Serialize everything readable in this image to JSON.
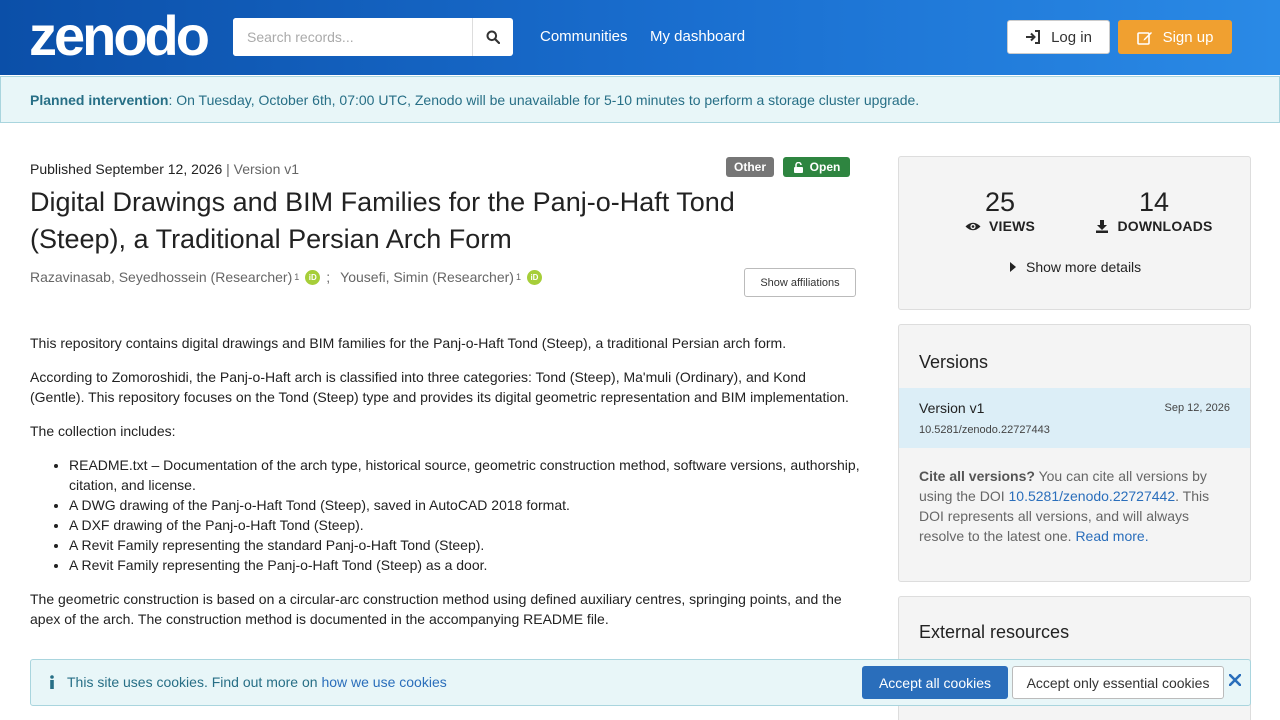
{
  "header": {
    "logo": "zenodo",
    "search_placeholder": "Search records...",
    "nav": [
      "Communities",
      "My dashboard"
    ],
    "login_label": "Log in",
    "signup_label": "Sign up",
    "signup_color": "#f0a030"
  },
  "banner": {
    "bold": "Planned intervention",
    "text": ": On Tuesday, October 6th, 07:00 UTC, Zenodo will be unavailable for 5-10 minutes to perform a storage cluster upgrade."
  },
  "record": {
    "published": "Published September 12, 2026",
    "separator": "|",
    "version": "Version v1",
    "badge_type": "Other",
    "badge_access": "Open",
    "title": "Digital Drawings and BIM Families for the Panj-o-Haft Tond (Steep), a Traditional Persian Arch Form",
    "authors": [
      {
        "name": "Razavinasab, Seyedhossein (Researcher)",
        "sup": "1"
      },
      {
        "name": "Yousefi, Simin (Researcher)",
        "sup": "1"
      }
    ],
    "author_sep": ";",
    "show_affiliations": "Show affiliations",
    "description": {
      "p1": "This repository contains digital drawings and BIM families for the Panj-o-Haft Tond (Steep), a traditional Persian arch form.",
      "p2": "According to Zomoroshidi, the Panj-o-Haft arch is classified into three categories: Tond (Steep), Ma'muli (Ordinary), and Kond (Gentle). This repository focuses on the Tond (Steep) type and provides its digital geometric representation and BIM implementation.",
      "p3": "The collection includes:",
      "items": [
        "README.txt – Documentation of the arch type, historical source, geometric construction method, software versions, authorship, citation, and license.",
        "A DWG drawing of the Panj-o-Haft Tond (Steep), saved in AutoCAD 2018 format.",
        "A DXF drawing of the Panj-o-Haft Tond (Steep).",
        "A Revit Family representing the standard Panj-o-Haft Tond (Steep).",
        "A Revit Family representing the Panj-o-Haft Tond (Steep) as a door."
      ],
      "p4": "The geometric construction is based on a circular-arc construction method using defined auxiliary centres, springing points, and the apex of the arch. The construction method is documented in the accompanying README file."
    }
  },
  "stats": {
    "views": "25",
    "views_label": "VIEWS",
    "downloads": "14",
    "downloads_label": "DOWNLOADS",
    "more": "Show more details"
  },
  "versions": {
    "title": "Versions",
    "current": {
      "name": "Version v1",
      "date": "Sep 12, 2026",
      "doi": "10.5281/zenodo.22727443"
    },
    "cite_bold": "Cite all versions?",
    "cite_text1": " You can cite all versions by using the DOI ",
    "cite_doi": "10.5281/zenodo.22727442",
    "cite_text2": ". This DOI represents all versions, and will always resolve to the latest one. ",
    "read_more": "Read more."
  },
  "external": {
    "title": "External resources"
  },
  "cookie": {
    "text": "This site uses cookies. Find out more on ",
    "link": "how we use cookies",
    "accept_all": "Accept all cookies",
    "accept_essential": "Accept only essential cookies"
  }
}
